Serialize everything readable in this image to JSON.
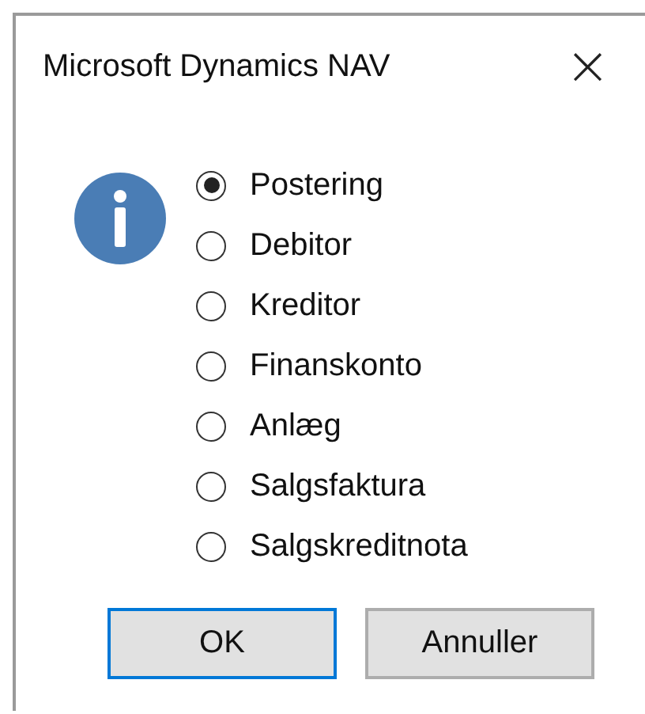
{
  "window": {
    "title": "Microsoft Dynamics NAV",
    "close": "×"
  },
  "options": [
    {
      "label": "Postering",
      "selected": true
    },
    {
      "label": "Debitor",
      "selected": false
    },
    {
      "label": "Kreditor",
      "selected": false
    },
    {
      "label": "Finanskonto",
      "selected": false
    },
    {
      "label": "Anlæg",
      "selected": false
    },
    {
      "label": "Salgsfaktura",
      "selected": false
    },
    {
      "label": "Salgskreditnota",
      "selected": false
    }
  ],
  "buttons": [
    {
      "label": "OK",
      "default": true
    },
    {
      "label": "Annuller",
      "default": false
    }
  ]
}
